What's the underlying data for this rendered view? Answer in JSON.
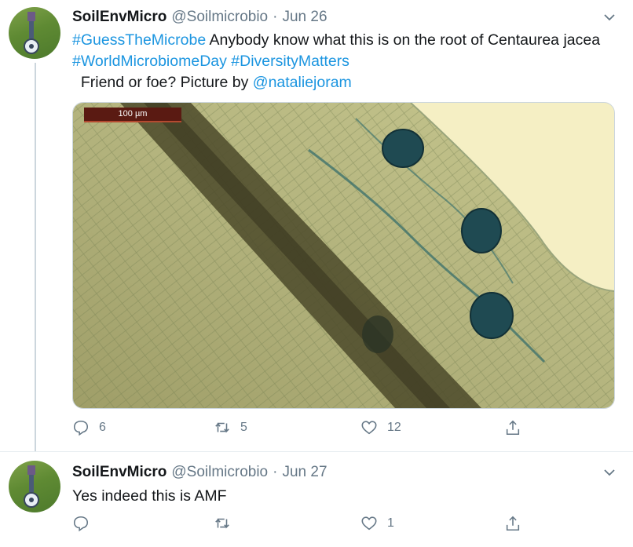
{
  "tweets": [
    {
      "name": "SoilEnvMicro",
      "handle": "@Soilmicrobio",
      "separator": "·",
      "date": "Jun 26",
      "text": {
        "hashtag1": "#GuessTheMicrobe",
        "body1": " Anybody know what this is on the root of Centaurea jacea ",
        "hashtag2": "#WorldMicrobiomeDay",
        "space": " ",
        "hashtag3": "#DiversityMatters",
        "body2": "  Friend or foe? Picture by ",
        "mention": "@nataliejoram"
      },
      "media": {
        "scale_label": "100 µm"
      },
      "actions": {
        "replies": "6",
        "retweets": "5",
        "likes": "12"
      }
    },
    {
      "name": "SoilEnvMicro",
      "handle": "@Soilmicrobio",
      "separator": "·",
      "date": "Jun 27",
      "text": {
        "body": "Yes indeed this is AMF"
      },
      "actions": {
        "likes": "1"
      }
    }
  ],
  "icons": {
    "reply": "reply-icon",
    "retweet": "retweet-icon",
    "like": "heart-icon",
    "share": "share-icon",
    "menu": "chevron-down-icon"
  },
  "colors": {
    "link": "#1b95e0",
    "secondary": "#657786",
    "text": "#14171a"
  }
}
